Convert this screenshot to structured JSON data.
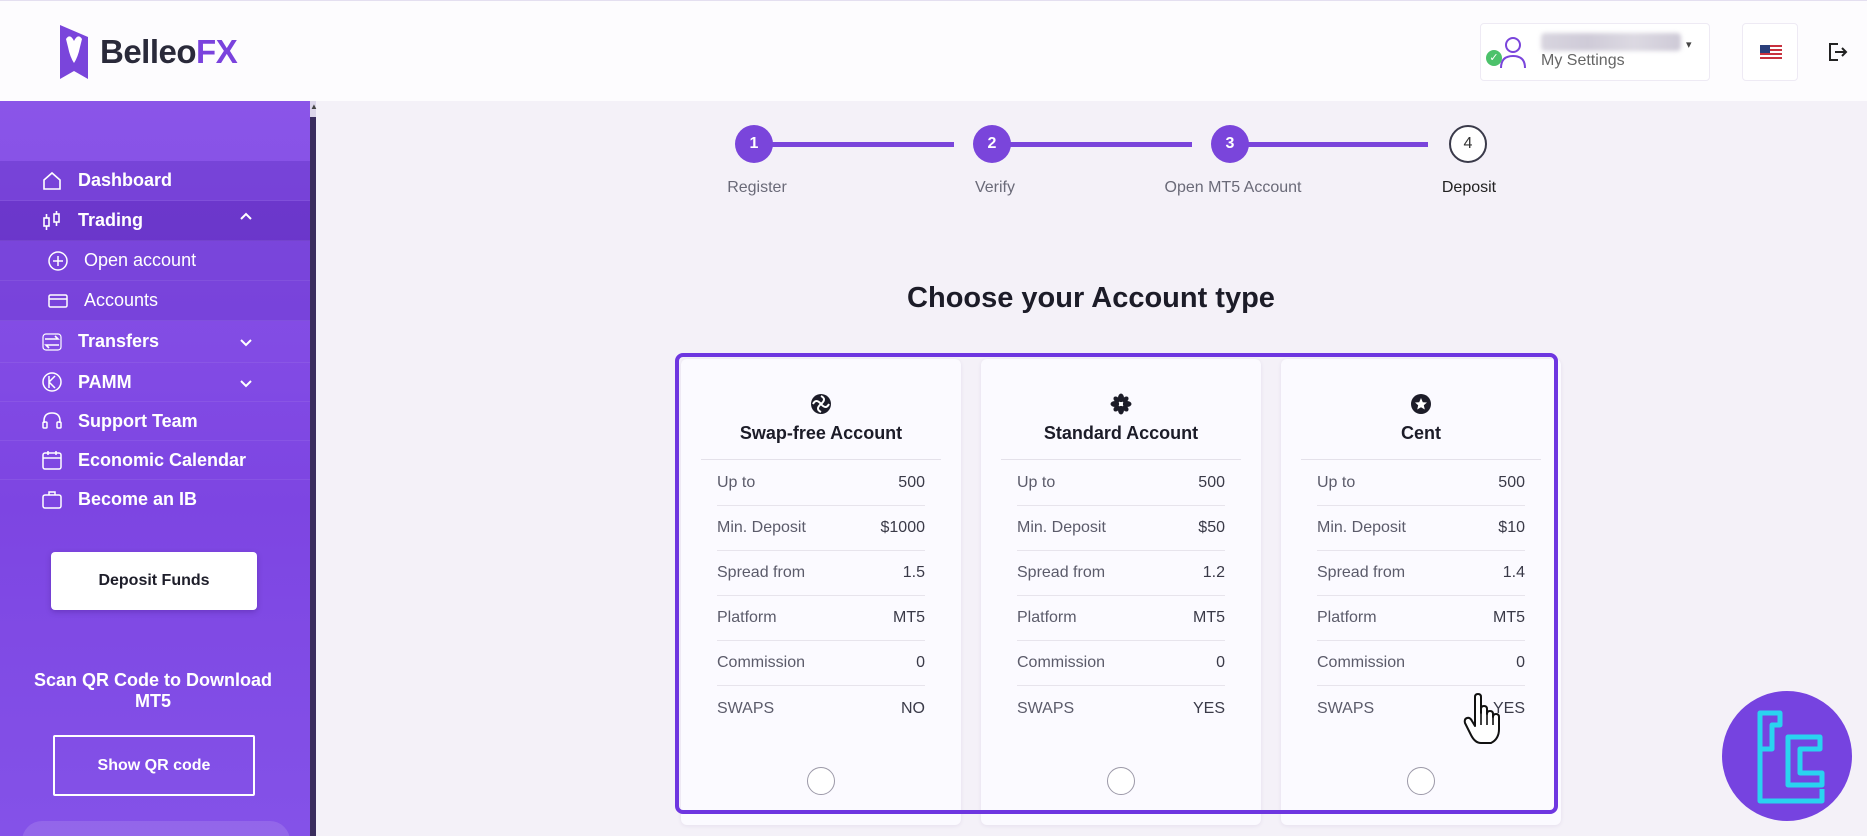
{
  "header": {
    "logo_text_main": "Belleo",
    "logo_text_accent": "FX",
    "settings_label": "My Settings"
  },
  "sidebar": {
    "items": [
      {
        "label": "Dashboard",
        "icon": "home-icon"
      },
      {
        "label": "Trading",
        "icon": "trading-icon"
      },
      {
        "label": "Open account",
        "icon": "plus-circle-icon"
      },
      {
        "label": "Accounts",
        "icon": "card-icon"
      },
      {
        "label": "Transfers",
        "icon": "transfer-icon"
      },
      {
        "label": "PAMM",
        "icon": "pamm-icon"
      },
      {
        "label": "Support Team",
        "icon": "headset-icon"
      },
      {
        "label": "Economic Calendar",
        "icon": "calendar-icon"
      },
      {
        "label": "Become an IB",
        "icon": "briefcase-icon"
      }
    ],
    "deposit_button": "Deposit Funds",
    "qr_text": "Scan QR Code to Download MT5",
    "qr_button": "Show QR code"
  },
  "stepper": {
    "steps": [
      {
        "number": "1",
        "label": "Register"
      },
      {
        "number": "2",
        "label": "Verify"
      },
      {
        "number": "3",
        "label": "Open MT5 Account"
      },
      {
        "number": "4",
        "label": "Deposit"
      }
    ]
  },
  "main": {
    "title": "Choose your Account type",
    "accounts": [
      {
        "name": "Swap-free Account",
        "icon": "swirl-icon",
        "rows": [
          {
            "label": "Up to",
            "value": "500"
          },
          {
            "label": "Min. Deposit",
            "value": "$1000"
          },
          {
            "label": "Spread from",
            "value": "1.5"
          },
          {
            "label": "Platform",
            "value": "MT5"
          },
          {
            "label": "Commission",
            "value": "0"
          },
          {
            "label": "SWAPS",
            "value": "NO"
          }
        ]
      },
      {
        "name": "Standard Account",
        "icon": "flower-icon",
        "rows": [
          {
            "label": "Up to",
            "value": "500"
          },
          {
            "label": "Min. Deposit",
            "value": "$50"
          },
          {
            "label": "Spread from",
            "value": "1.2"
          },
          {
            "label": "Platform",
            "value": "MT5"
          },
          {
            "label": "Commission",
            "value": "0"
          },
          {
            "label": "SWAPS",
            "value": "YES"
          }
        ]
      },
      {
        "name": "Cent",
        "icon": "star-badge-icon",
        "rows": [
          {
            "label": "Up to",
            "value": "500"
          },
          {
            "label": "Min. Deposit",
            "value": "$10"
          },
          {
            "label": "Spread from",
            "value": "1.4"
          },
          {
            "label": "Platform",
            "value": "MT5"
          },
          {
            "label": "Commission",
            "value": "0"
          },
          {
            "label": "SWAPS",
            "value": "YES"
          }
        ]
      }
    ]
  },
  "colors": {
    "accent": "#7a45db",
    "sidebar": "#8452e8",
    "frame": "#6e36e0"
  }
}
